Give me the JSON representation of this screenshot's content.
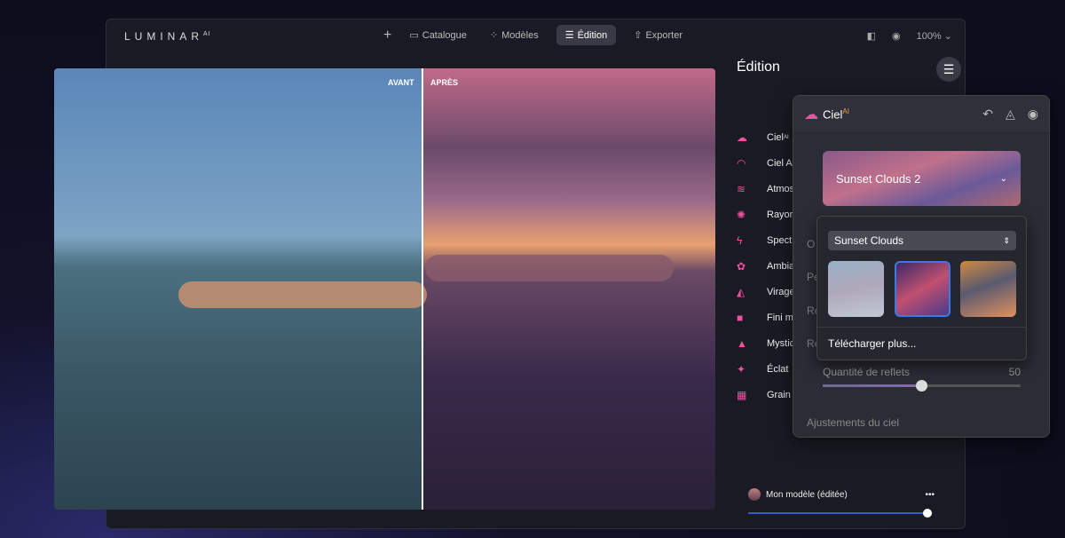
{
  "app": {
    "logo": "LUMINAR",
    "logo_sup": "AI"
  },
  "nav": [
    {
      "label": "Catalogue",
      "icon": "folder-icon"
    },
    {
      "label": "Modèles",
      "icon": "sparkle-icon"
    },
    {
      "label": "Édition",
      "icon": "sliders-icon",
      "active": true
    },
    {
      "label": "Exporter",
      "icon": "share-icon"
    }
  ],
  "view": {
    "zoom": "100%"
  },
  "photo": {
    "before": "AVANT",
    "after": "APRÈS"
  },
  "edit": {
    "title": "Édition"
  },
  "tools": [
    {
      "label": "Ciel",
      "sup": "AI",
      "icon": "cloud-icon"
    },
    {
      "label": "Ciel A",
      "icon": "rainbow-icon"
    },
    {
      "label": "Atmos",
      "icon": "waves-icon"
    },
    {
      "label": "Rayor",
      "icon": "sun-icon"
    },
    {
      "label": "Spect",
      "icon": "bolt-icon"
    },
    {
      "label": "Ambia",
      "icon": "lotus-icon"
    },
    {
      "label": "Virage",
      "icon": "bucket-icon"
    },
    {
      "label": "Fini m",
      "icon": "square-icon"
    },
    {
      "label": "Mystic",
      "icon": "cone-icon"
    },
    {
      "label": "Éclat",
      "icon": "sparkle-icon"
    },
    {
      "label": "Grain",
      "icon": "film-icon"
    }
  ],
  "panel": {
    "title": "Ciel",
    "sup": "AI",
    "sky_selected": "Sunset Clouds 2",
    "hidden_rows": [
      "O",
      "Pe",
      "Re",
      "Re"
    ],
    "reflect_label": "Quantité de reflets",
    "reflect_value": "50",
    "reflect_percent": 50,
    "sky_adjust": "Ajustements du ciel"
  },
  "popover": {
    "category": "Sunset Clouds",
    "selected_index": 1,
    "download": "Télécharger plus..."
  },
  "footer": {
    "model": "Mon modèle (éditée)",
    "more": "•••",
    "amount_percent": 100
  },
  "colors": {
    "accent": "#f050a0",
    "select": "#3a7ae8"
  }
}
